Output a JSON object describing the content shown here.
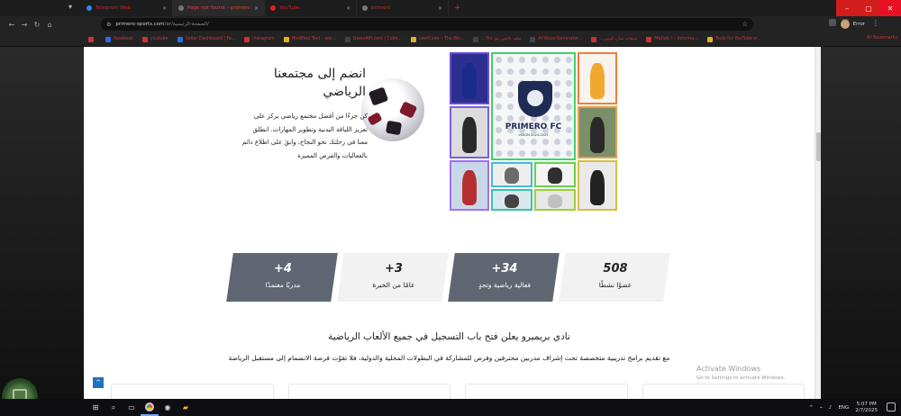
{
  "browser": {
    "tabs": [
      {
        "label": "Telegram Web",
        "icon": "telegram-icon",
        "active": false
      },
      {
        "label": "Page not found – primero",
        "icon": "page-icon",
        "active": true
      },
      {
        "label": "YouTube",
        "icon": "youtube-icon",
        "active": false
      },
      {
        "label": "primero",
        "icon": "page-icon",
        "active": false
      }
    ],
    "new_tab": "+",
    "address": {
      "domain": "primero-sports.com",
      "path": "/ar/الصفحة-الرئيسية/"
    },
    "profile_name": "Error",
    "bookmarks": [
      {
        "label": "",
        "icon": "youtube-icon"
      },
      {
        "label": "facebook",
        "icon": "facebook-icon"
      },
      {
        "label": "youtube",
        "icon": "youtube-icon"
      },
      {
        "label": "Seller Dashboard | Fa...",
        "icon": "dashboard-icon"
      },
      {
        "label": "instagram",
        "icon": "instagram-icon"
      },
      {
        "label": "Modified Text – Jee...",
        "icon": "text-icon"
      },
      {
        "label": "OwenAPI.com | Colle...",
        "icon": "web-icon"
      },
      {
        "label": "LeetCode – The Wo...",
        "icon": "leetcode-icon"
      },
      {
        "label": "...Ytz ملف بالنص بنق",
        "icon": "web-icon"
      },
      {
        "label": "AI Voice Generator...",
        "icon": "voice-icon"
      },
      {
        "label": "...مبيعات ميان الوبين",
        "icon": "web-icon"
      },
      {
        "label": "Matlab ! – Informa...",
        "icon": "matlab-icon"
      },
      {
        "label": "Tools for YouTube vi...",
        "icon": "tools-icon"
      }
    ],
    "all_bookmarks": "All Bookmarks"
  },
  "page": {
    "join": {
      "title": "انضم إلى مجتمعنا الرياضي",
      "body": "كن جزءًا من أفضل مجتمع رياضي يركز على تعزيز اللياقة البدنية وتطوير المهارات. انطلق معنا في رحلتك نحو النجاح، وابقَ على اطلاع دائم بالفعاليات والفرص المميزة"
    },
    "collage_logo": {
      "name": "PRIMERO FC",
      "sub": "VISION 2024-2025"
    },
    "stats": [
      {
        "num": "508",
        "label": "عضوًا نشطًا",
        "style": "light"
      },
      {
        "num": "+34",
        "label": "فعالية رياضية وتحدٍ",
        "style": "dark"
      },
      {
        "num": "+3",
        "label": "عامًا من الخبرة",
        "style": "light"
      },
      {
        "num": "+4",
        "label": "مدربًا معتمدًا",
        "style": "dark"
      }
    ],
    "announcement": {
      "title": "نادي بريميرو يعلن فتح باب التسجيل في جميع الألعاب الرياضية",
      "body": "مع تقديم برامج تدريبية متخصصة تحت إشراف مدربين محترفين وفرص للمشاركة في البطولات المحلية والدولية، فلا تفوّت فرصة الانضمام إلى مستقبل الرياضة"
    },
    "to_top": "^"
  },
  "os": {
    "watermark_title": "Activate Windows",
    "watermark_sub": "Go to Settings to activate Windows.",
    "lang": "ENG",
    "time": "5:07 PM",
    "date": "2/7/2025"
  },
  "colors": {
    "accent": "#e81123",
    "stat_dark": "#5f6672",
    "stat_light": "#f2f2f2",
    "link_blue": "#1e73be"
  }
}
